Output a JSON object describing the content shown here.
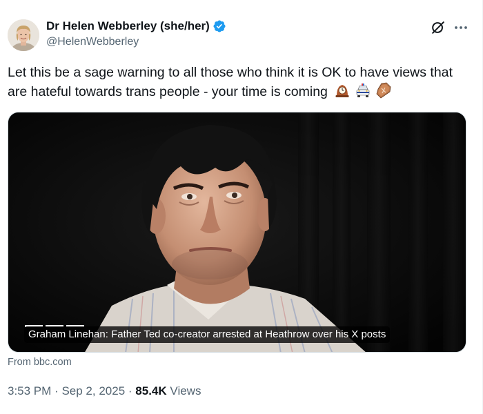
{
  "author": {
    "display_name": "Dr Helen Webberley (she/her)",
    "handle": "@HelenWebberley",
    "verified": true
  },
  "header_actions": {
    "grok_icon": "grok-icon",
    "more_icon": "more-icon"
  },
  "tweet": {
    "text": "Let this be a sage warning to all those who think it is OK to have views that are hateful towards trans people - your time is coming",
    "emojis": [
      "mantelpiece-clock-icon",
      "police-car-icon",
      "coffin-icon"
    ]
  },
  "card": {
    "title": "Graham Linehan: Father Ted co-creator arrested at Heathrow over his X posts",
    "source": "From bbc.com"
  },
  "meta": {
    "time": "3:53 PM",
    "date": "Sep 2, 2025",
    "separator": "·",
    "views_count": "85.4K",
    "views_label": "Views"
  },
  "colors": {
    "text": "#0f1419",
    "secondary": "#536471",
    "verified": "#1d9bf0",
    "card_border": "#cfd9de"
  }
}
